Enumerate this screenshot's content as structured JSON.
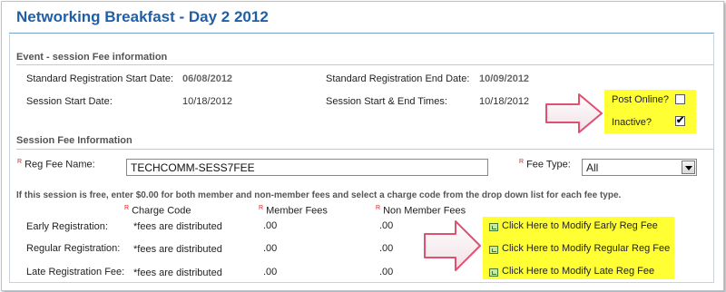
{
  "page": {
    "title": "Networking Breakfast - Day 2 2012"
  },
  "event_section": {
    "heading": "Event - session Fee information",
    "std_reg_start_label": "Standard Registration Start Date:",
    "std_reg_start_value": "06/08/2012",
    "std_reg_end_label": "Standard Registration End Date:",
    "std_reg_end_value": "10/09/2012",
    "session_start_label": "Session Start Date:",
    "session_start_value": "10/18/2012",
    "session_times_label": "Session Start & End Times:",
    "session_times_value": "10/18/2012",
    "post_online_label": "Post Online?",
    "post_online_checked": false,
    "inactive_label": "Inactive?",
    "inactive_checked": true,
    "check_mark": "✔"
  },
  "fee_section": {
    "heading": "Session Fee Information",
    "required_marker": "R",
    "reg_fee_name_label": "Reg Fee Name:",
    "reg_fee_name_value": "TECHCOMM-SESS7FEE",
    "fee_type_label": "Fee Type:",
    "fee_type_value": "All",
    "note": "If this session is free, enter $0.00 for both member and non-member fees and select a charge code from the drop down list for each fee type.",
    "columns": {
      "charge_code": "Charge Code",
      "member_fees": "Member Fees",
      "non_member_fees": "Non Member Fees"
    },
    "rows": [
      {
        "label": "Early Registration:",
        "charge_code": "*fees are distributed",
        "member": ".00",
        "non_member": ".00",
        "link": "Click Here to Modify Early Reg Fee"
      },
      {
        "label": "Regular Registration:",
        "charge_code": "*fees are distributed",
        "member": ".00",
        "non_member": ".00",
        "link": "Click Here to Modify Regular Reg Fee"
      },
      {
        "label": "Late Registration Fee:",
        "charge_code": "*fees are distributed",
        "member": ".00",
        "non_member": ".00",
        "link": "Click Here to Modify Late Reg Fee"
      }
    ]
  },
  "colors": {
    "title_blue": "#1f5fa8",
    "highlight_yellow": "#ffff33",
    "required_red": "#dd2222",
    "arrow_fill": "#ffffff",
    "arrow_stroke": "#e05070"
  },
  "icons": {
    "link_icon": "edit-fee-icon",
    "dropdown_icon": "chevron-down-icon",
    "arrow_annotation": "callout-arrow"
  }
}
